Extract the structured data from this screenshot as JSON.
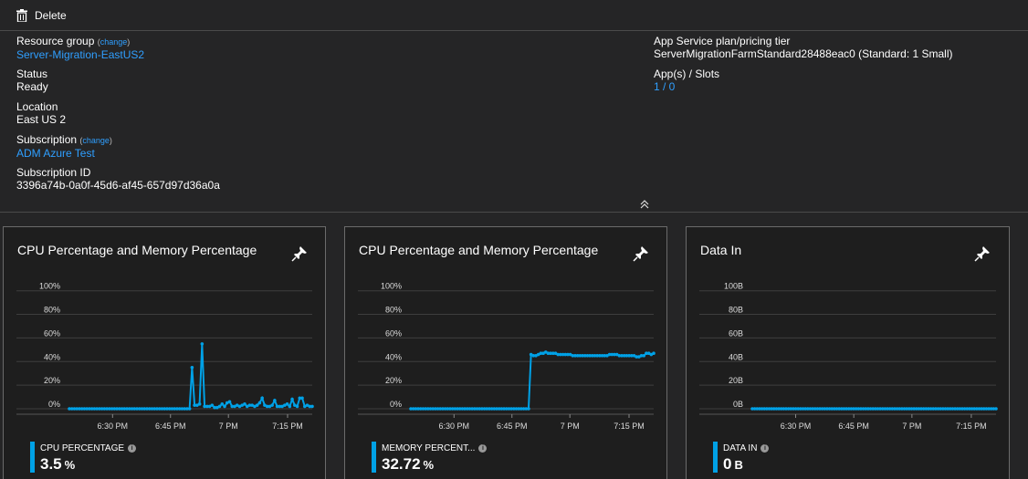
{
  "toolbar": {
    "delete_label": "Delete"
  },
  "essentials": {
    "resource_group": {
      "label": "Resource group",
      "change": "change",
      "value": "Server-Migration-EastUS2"
    },
    "status": {
      "label": "Status",
      "value": "Ready"
    },
    "location": {
      "label": "Location",
      "value": "East US 2"
    },
    "subscription": {
      "label": "Subscription",
      "change": "change",
      "value": "ADM Azure Test"
    },
    "subscription_id": {
      "label": "Subscription ID",
      "value": "3396a74b-0a0f-45d6-af45-657d97d36a0a"
    },
    "plan": {
      "label": "App Service plan/pricing tier",
      "value": "ServerMigrationFarmStandard28488eac0 (Standard: 1 Small)"
    },
    "apps": {
      "label": "App(s) / Slots",
      "value": "1 / 0"
    }
  },
  "tiles": [
    {
      "title": "CPU Percentage and Memory Percentage",
      "metric_label": "CPU PERCENTAGE",
      "metric_value": "3.5",
      "metric_unit": "%",
      "yticks": [
        "100%",
        "80%",
        "60%",
        "40%",
        "20%",
        "0%"
      ],
      "xticks": [
        "6:30 PM",
        "6:45 PM",
        "7 PM",
        "7:15 PM"
      ]
    },
    {
      "title": "CPU Percentage and Memory Percentage",
      "metric_label": "MEMORY PERCENT...",
      "metric_value": "32.72",
      "metric_unit": "%",
      "yticks": [
        "100%",
        "80%",
        "60%",
        "40%",
        "20%",
        "0%"
      ],
      "xticks": [
        "6:30 PM",
        "6:45 PM",
        "7 PM",
        "7:15 PM"
      ]
    },
    {
      "title": "Data In",
      "metric_label": "DATA IN",
      "metric_value": "0",
      "metric_unit": "B",
      "yticks": [
        "100B",
        "80B",
        "60B",
        "40B",
        "20B",
        "0B"
      ],
      "xticks": [
        "6:30 PM",
        "6:45 PM",
        "7 PM",
        "7:15 PM"
      ]
    }
  ],
  "chart_data": [
    {
      "type": "line",
      "ylim": [
        0,
        100
      ],
      "xticks": [
        "6:30 PM",
        "6:45 PM",
        "7 PM",
        "7:15 PM"
      ],
      "yticks": [
        "100%",
        "80%",
        "60%",
        "40%",
        "20%",
        "0%"
      ],
      "series": [
        {
          "name": "CPU PERCENTAGE",
          "color": "#00a1e6",
          "values": [
            0,
            0,
            0,
            0,
            0,
            0,
            0,
            0,
            0,
            0,
            0,
            0,
            0,
            0,
            0,
            0,
            0,
            0,
            0,
            0,
            0,
            0,
            0,
            0,
            0,
            0,
            0,
            0,
            0,
            0,
            0,
            0,
            0,
            0,
            0,
            0,
            0,
            0,
            0,
            0,
            0,
            0,
            0,
            0,
            0,
            0,
            0,
            0,
            0,
            35,
            3,
            3,
            4,
            55,
            2,
            2,
            2,
            3,
            1,
            1,
            2,
            4,
            2,
            5,
            6,
            2,
            2,
            3,
            2,
            3,
            4,
            2,
            3,
            3,
            2,
            3,
            5,
            9,
            3,
            2,
            2,
            3,
            7,
            2,
            2,
            2,
            3,
            4,
            2,
            8,
            3,
            2,
            9,
            9,
            2,
            3,
            2,
            2
          ]
        }
      ]
    },
    {
      "type": "line",
      "ylim": [
        0,
        100
      ],
      "xticks": [
        "6:30 PM",
        "6:45 PM",
        "7 PM",
        "7:15 PM"
      ],
      "yticks": [
        "100%",
        "80%",
        "60%",
        "40%",
        "20%",
        "0%"
      ],
      "series": [
        {
          "name": "MEMORY PERCENT...",
          "color": "#00a1e6",
          "values": [
            0,
            0,
            0,
            0,
            0,
            0,
            0,
            0,
            0,
            0,
            0,
            0,
            0,
            0,
            0,
            0,
            0,
            0,
            0,
            0,
            0,
            0,
            0,
            0,
            0,
            0,
            0,
            0,
            0,
            0,
            0,
            0,
            0,
            0,
            0,
            0,
            0,
            0,
            0,
            0,
            0,
            0,
            0,
            0,
            0,
            0,
            0,
            0,
            0,
            46,
            45,
            45,
            46,
            47,
            47,
            48,
            47,
            47,
            47,
            47,
            46,
            46,
            46,
            46,
            46,
            46,
            45,
            45,
            45,
            45,
            45,
            45,
            45,
            45,
            45,
            45,
            45,
            45,
            45,
            45,
            45,
            46,
            46,
            46,
            46,
            45,
            45,
            45,
            45,
            45,
            45,
            45,
            44,
            44,
            45,
            45,
            47,
            47,
            46,
            47
          ]
        }
      ]
    },
    {
      "type": "line",
      "ylim": [
        0,
        100
      ],
      "xticks": [
        "6:30 PM",
        "6:45 PM",
        "7 PM",
        "7:15 PM"
      ],
      "yticks": [
        "100B",
        "80B",
        "60B",
        "40B",
        "20B",
        "0B"
      ],
      "series": [
        {
          "name": "DATA IN",
          "color": "#00a1e6",
          "values": [
            0,
            0,
            0,
            0,
            0,
            0,
            0,
            0,
            0,
            0,
            0,
            0,
            0,
            0,
            0,
            0,
            0,
            0,
            0,
            0,
            0,
            0,
            0,
            0,
            0,
            0,
            0,
            0,
            0,
            0,
            0,
            0,
            0,
            0,
            0,
            0,
            0,
            0,
            0,
            0,
            0,
            0,
            0,
            0,
            0,
            0,
            0,
            0,
            0,
            0,
            0,
            0,
            0,
            0,
            0,
            0,
            0,
            0,
            0,
            0,
            0,
            0,
            0,
            0,
            0,
            0,
            0,
            0,
            0,
            0,
            0,
            0,
            0,
            0,
            0,
            0,
            0,
            0,
            0,
            0,
            0,
            0,
            0,
            0,
            0,
            0,
            0,
            0,
            0,
            0,
            0,
            0,
            0,
            0,
            0,
            0,
            0,
            0,
            0,
            0,
            0,
            0
          ]
        }
      ]
    }
  ]
}
